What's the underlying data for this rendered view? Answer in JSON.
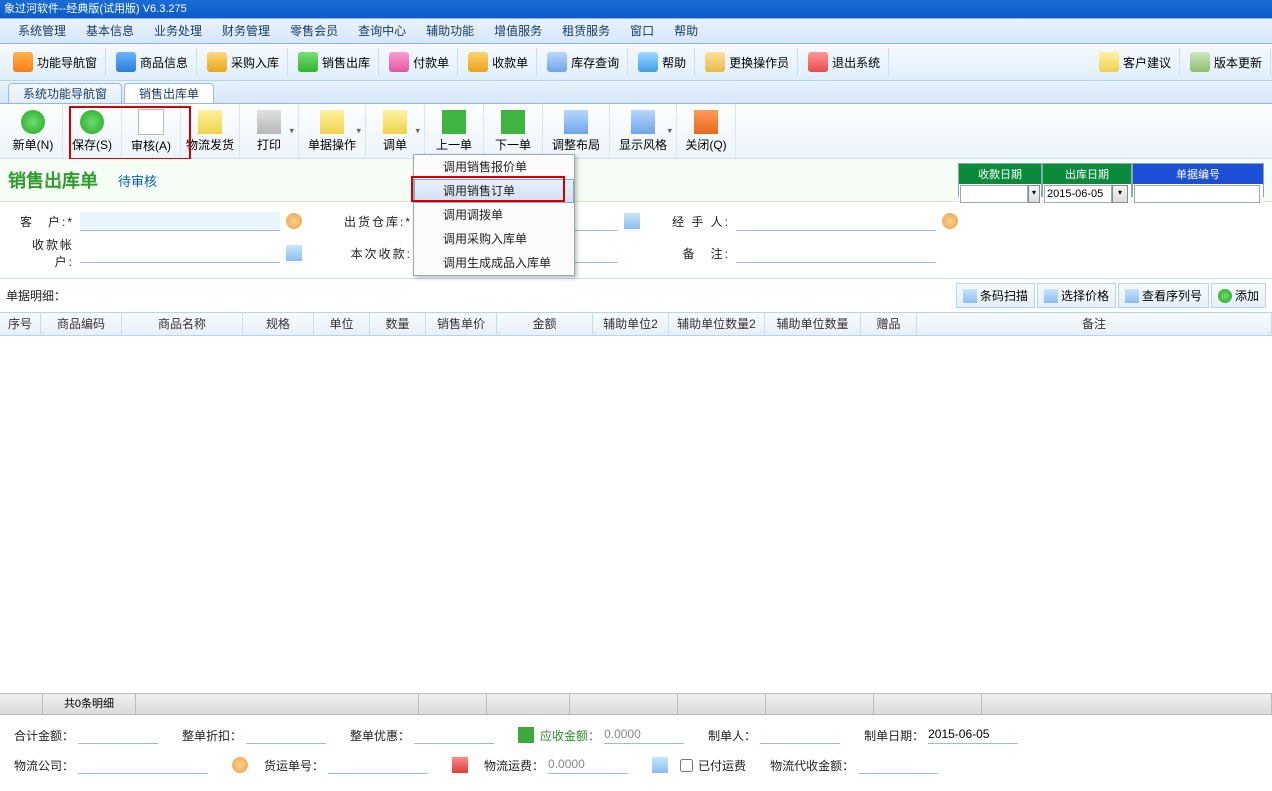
{
  "title_bar": "象过河软件--经典版(试用版)  V6.3.275",
  "menu": [
    "系统管理",
    "基本信息",
    "业务处理",
    "财务管理",
    "零售会员",
    "查询中心",
    "辅助功能",
    "增值服务",
    "租赁服务",
    "窗口",
    "帮助"
  ],
  "main_toolbar": {
    "l": [
      "功能导航窗",
      "商品信息",
      "采购入库",
      "销售出库",
      "付款单",
      "收款单",
      "库存查询",
      "帮助",
      "更换操作员",
      "退出系统"
    ],
    "r": [
      "客户建议",
      "版本更新"
    ]
  },
  "tabs": [
    "系统功能导航窗",
    "销售出库单"
  ],
  "doc_toolbar": [
    "新单(N)",
    "保存(S)",
    "审核(A)",
    "物流发货",
    "打印",
    "单据操作",
    "调单",
    "上一单",
    "下一单",
    "调整布局",
    "显示风格",
    "关闭(Q)"
  ],
  "drop_items": [
    "调用销售报价单",
    "调用销售订单",
    "调用调拨单",
    "调用采购入库单",
    "调用生成成品入库单"
  ],
  "header": {
    "doc_title": "销售出库单",
    "status": "待审核"
  },
  "date_panel": {
    "c0": {
      "h": "收款日期",
      "v": ""
    },
    "c1": {
      "h": "出库日期",
      "v": "2015-06-05"
    },
    "c2": {
      "h": "单据编号",
      "v": ""
    }
  },
  "form": {
    "customer_l": "客　户:*",
    "customer_v": "",
    "warehouse_l": "出货仓库:*",
    "warehouse_v": "",
    "handler_l": "经 手 人:",
    "handler_v": "",
    "acct_l": "收款帐户:",
    "acct_v": "",
    "thispay_l": "本次收款:",
    "thispay_v": "",
    "remark_l": "备　注:",
    "remark_v": ""
  },
  "detail_label": "单据明细：",
  "action_btns": [
    "条码扫描",
    "选择价格",
    "查看序列号",
    "添加"
  ],
  "cols": [
    "序号",
    "商品编码",
    "商品名称",
    "规格",
    "单位",
    "数量",
    "销售单价",
    "金额",
    "辅助单位2",
    "辅助单位数量2",
    "辅助单位数量",
    "赠品",
    "备注"
  ],
  "footer_summary": "共0条明细",
  "footer": {
    "total_l": "合计金额：",
    "total_v": "",
    "disc_l": "整单折扣：",
    "disc_v": "",
    "pref_l": "整单优惠：",
    "pref_v": "",
    "recv_l": "应收金额：",
    "recv_v": "0.0000",
    "maker_l": "制单人：",
    "maker_v": "",
    "makedate_l": "制单日期：",
    "makedate_v": "2015-06-05",
    "logco_l": "物流公司：",
    "logco_v": "",
    "shipno_l": "货运单号：",
    "shipno_v": "",
    "shipfee_l": "物流运费：",
    "shipfee_v": "0.0000",
    "paid_l": "已付运费",
    "agent_l": "物流代收金额：",
    "agent_v": ""
  }
}
